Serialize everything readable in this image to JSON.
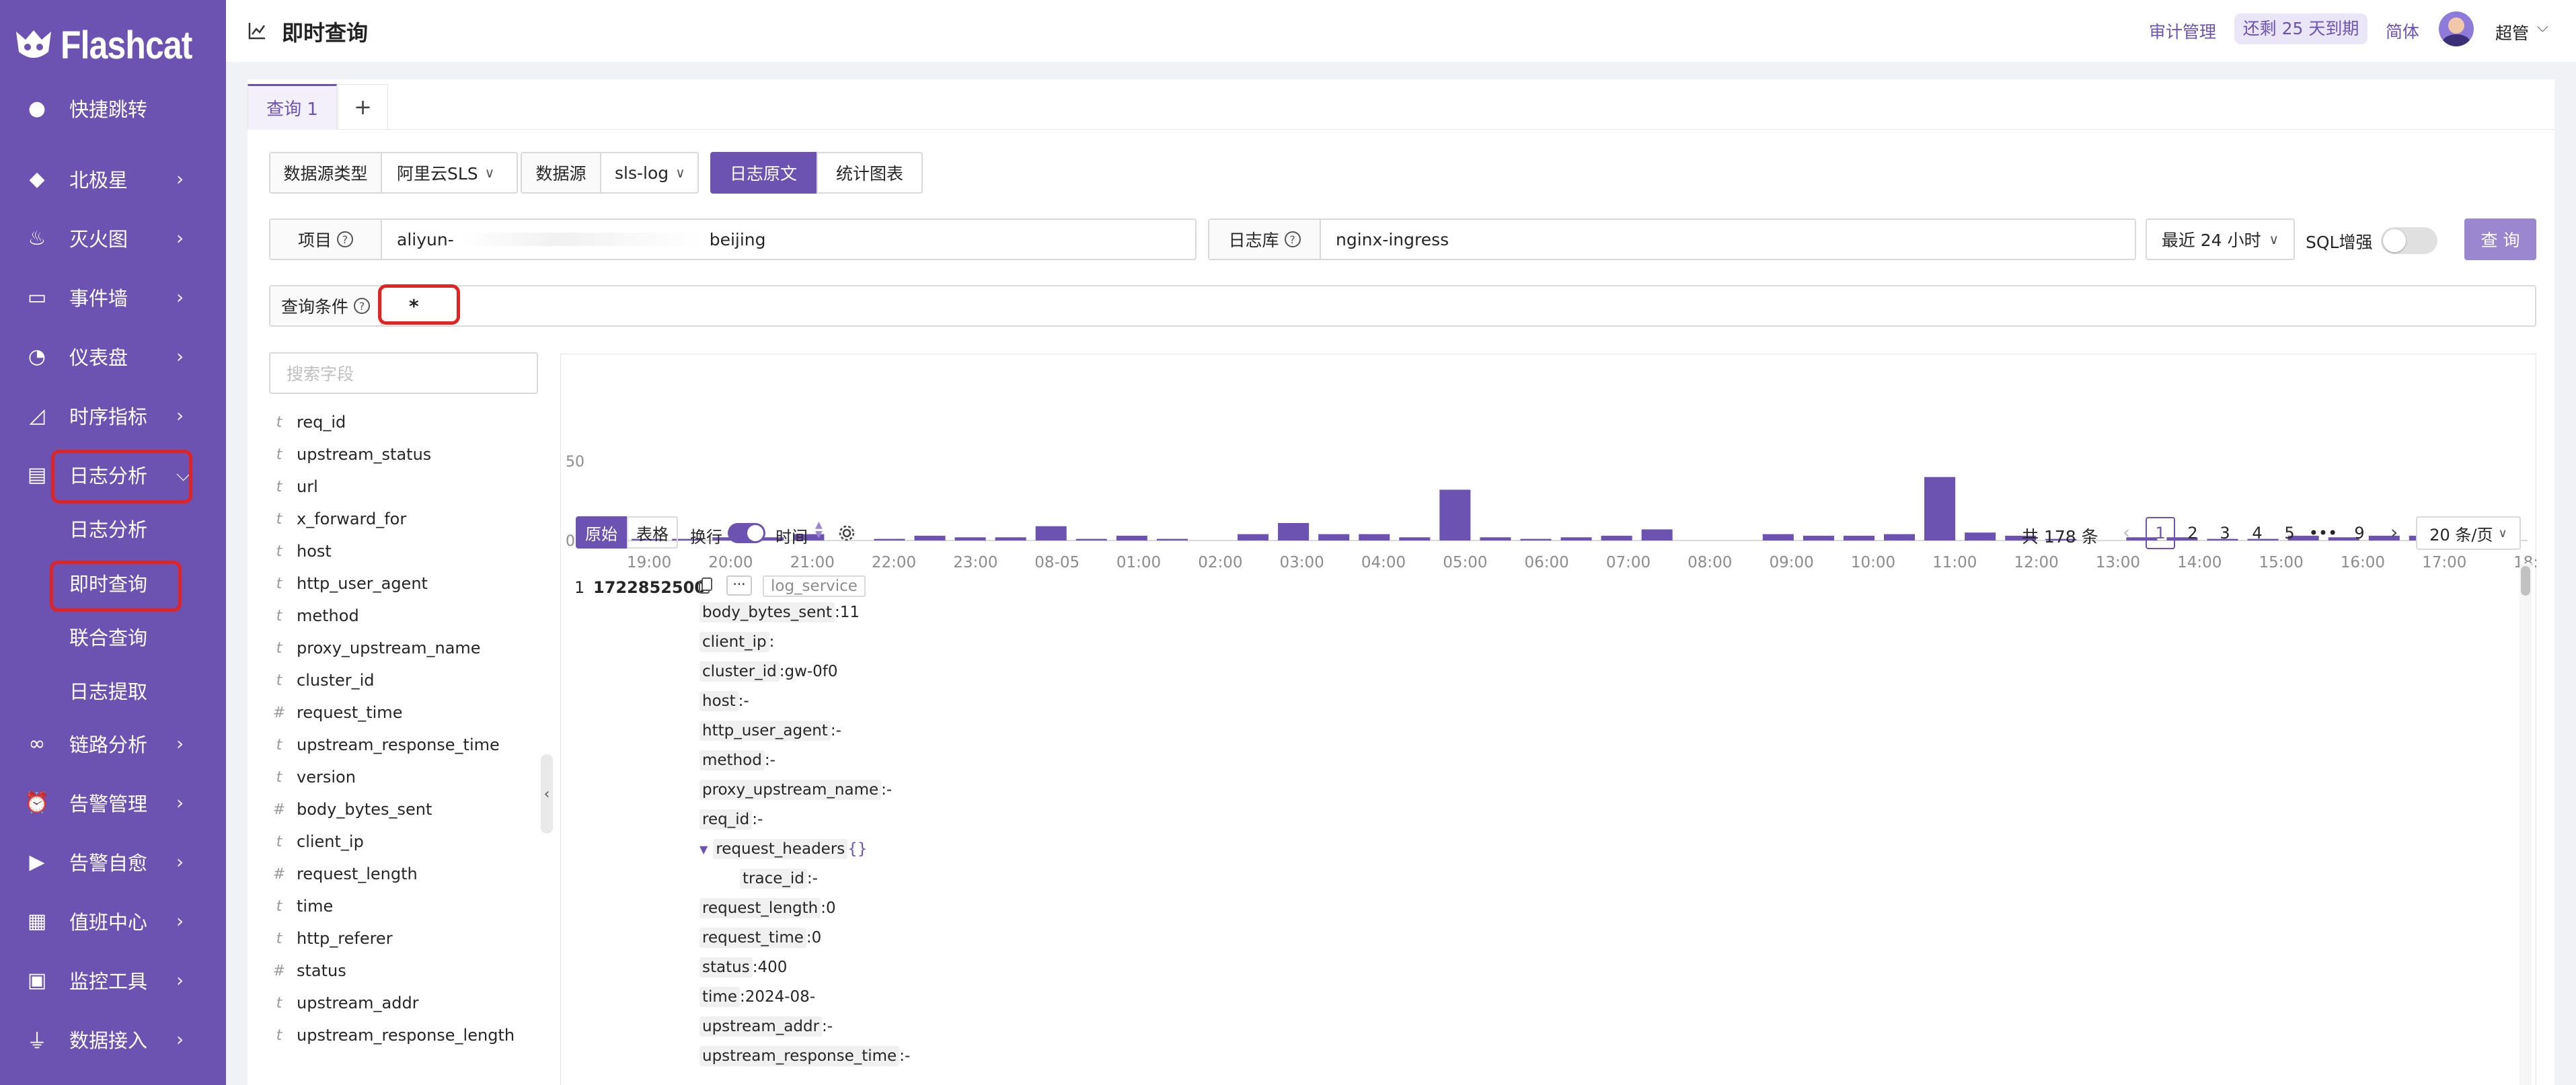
{
  "app": {
    "logo_text": "Flashcat"
  },
  "sidebar": {
    "items": [
      {
        "label": "快捷跳转",
        "icon": "search-icon",
        "arrow": false
      },
      {
        "label": "北极星",
        "icon": "compass-icon",
        "arrow": true
      },
      {
        "label": "灭火图",
        "icon": "fire-icon",
        "arrow": true
      },
      {
        "label": "事件墙",
        "icon": "monitor-icon",
        "arrow": true
      },
      {
        "label": "仪表盘",
        "icon": "gauge-icon",
        "arrow": true
      },
      {
        "label": "时序指标",
        "icon": "line-chart-icon",
        "arrow": true
      },
      {
        "label": "日志分析",
        "icon": "clipboard-icon",
        "arrow": true,
        "expanded": true
      },
      {
        "label": "链路分析",
        "icon": "link-icon",
        "arrow": true
      },
      {
        "label": "告警管理",
        "icon": "alarm-icon",
        "arrow": true
      },
      {
        "label": "告警自愈",
        "icon": "terminal-icon",
        "arrow": true
      },
      {
        "label": "值班中心",
        "icon": "calendar-icon",
        "arrow": true
      },
      {
        "label": "监控工具",
        "icon": "toolbox-icon",
        "arrow": true
      },
      {
        "label": "数据接入",
        "icon": "plug-icon",
        "arrow": true
      }
    ],
    "log_sub_items": [
      "日志分析",
      "即时查询",
      "联合查询",
      "日志提取"
    ]
  },
  "header": {
    "page_title": "即时查询",
    "audit_link": "审计管理",
    "expiry_badge": "还剩 25 天到期",
    "language": "简体",
    "username": "超管"
  },
  "query_tabs": {
    "tabs": [
      "查询 1"
    ],
    "add_label": "+"
  },
  "datasource": {
    "type_label": "数据源类型",
    "type_value": "阿里云SLS",
    "source_label": "数据源",
    "source_value": "sls-log",
    "mode_log": "日志原文",
    "mode_chart": "统计图表"
  },
  "filters": {
    "project_label": "项目",
    "project_value_start": "aliyun-",
    "project_value_end": "beijing",
    "logstore_label": "日志库",
    "logstore_value": "nginx-ingress",
    "time_range": "最近 24 小时",
    "sql_label": "SQL增强",
    "query_button": "查 询",
    "condition_label": "查询条件",
    "condition_value": "*"
  },
  "field_search": {
    "placeholder": "搜索字段"
  },
  "fields": [
    {
      "type": "t",
      "name": "req_id"
    },
    {
      "type": "t",
      "name": "upstream_status"
    },
    {
      "type": "t",
      "name": "url"
    },
    {
      "type": "t",
      "name": "x_forward_for"
    },
    {
      "type": "t",
      "name": "host"
    },
    {
      "type": "t",
      "name": "http_user_agent"
    },
    {
      "type": "t",
      "name": "method"
    },
    {
      "type": "t",
      "name": "proxy_upstream_name"
    },
    {
      "type": "t",
      "name": "cluster_id"
    },
    {
      "type": "#",
      "name": "request_time"
    },
    {
      "type": "t",
      "name": "upstream_response_time"
    },
    {
      "type": "t",
      "name": "version"
    },
    {
      "type": "#",
      "name": "body_bytes_sent"
    },
    {
      "type": "t",
      "name": "client_ip"
    },
    {
      "type": "#",
      "name": "request_length"
    },
    {
      "type": "t",
      "name": "time"
    },
    {
      "type": "t",
      "name": "http_referer"
    },
    {
      "type": "#",
      "name": "status"
    },
    {
      "type": "t",
      "name": "upstream_addr"
    },
    {
      "type": "t",
      "name": "upstream_response_length"
    }
  ],
  "chart_data": {
    "type": "bar",
    "ylim": [
      0,
      50
    ],
    "y_ticks": [
      "50",
      "0"
    ],
    "x_ticks": [
      "19:00",
      "20:00",
      "21:00",
      "22:00",
      "23:00",
      "08-05",
      "01:00",
      "02:00",
      "03:00",
      "04:00",
      "05:00",
      "06:00",
      "07:00",
      "08:00",
      "09:00",
      "10:00",
      "11:00",
      "12:00",
      "13:00",
      "14:00",
      "15:00",
      "16:00",
      "17:00",
      "18:"
    ],
    "values": [
      4,
      1,
      1,
      2,
      2,
      4,
      0,
      1,
      3,
      2,
      2,
      9,
      1,
      3,
      1,
      0,
      4,
      11,
      4,
      4,
      2,
      32,
      2,
      1,
      2,
      3,
      7,
      0,
      0,
      4,
      3,
      3,
      4,
      40,
      5,
      3,
      1,
      0,
      2,
      2,
      1,
      1,
      3,
      2,
      3,
      3,
      3,
      2
    ]
  },
  "results_toolbar": {
    "view_raw": "原始",
    "view_table": "表格",
    "wrap_label": "换行",
    "time_label": "时间",
    "total": "共 178 条",
    "pages": [
      "1",
      "2",
      "3",
      "4",
      "5",
      "•••",
      "9"
    ],
    "page_size": "20 条/页"
  },
  "log_entry": {
    "index": "1",
    "timestamp": "1722852500",
    "tag": "log_service",
    "fields": [
      {
        "key": "body_bytes_sent",
        "value": "11"
      },
      {
        "key": "client_ip",
        "value": ""
      },
      {
        "key": "cluster_id",
        "value": "gw-0f0"
      },
      {
        "key": "host",
        "value": "-"
      },
      {
        "key": "http_user_agent",
        "value": "-"
      },
      {
        "key": "method",
        "value": "-"
      },
      {
        "key": "proxy_upstream_name",
        "value": "-"
      },
      {
        "key": "req_id",
        "value": "-"
      },
      {
        "key": "request_headers",
        "value": "{}"
      },
      {
        "key": "trace_id",
        "value": "-"
      },
      {
        "key": "request_length",
        "value": "0"
      },
      {
        "key": "request_time",
        "value": "0"
      },
      {
        "key": "status",
        "value": "400"
      },
      {
        "key": "time",
        "value": "2024-08-"
      },
      {
        "key": "upstream_addr",
        "value": "-"
      },
      {
        "key": "upstream_response_time",
        "value": "-"
      }
    ]
  },
  "colors": {
    "sidebar": "#6c53b1",
    "accent": "#6c53b1",
    "highlight": "#e02424"
  }
}
